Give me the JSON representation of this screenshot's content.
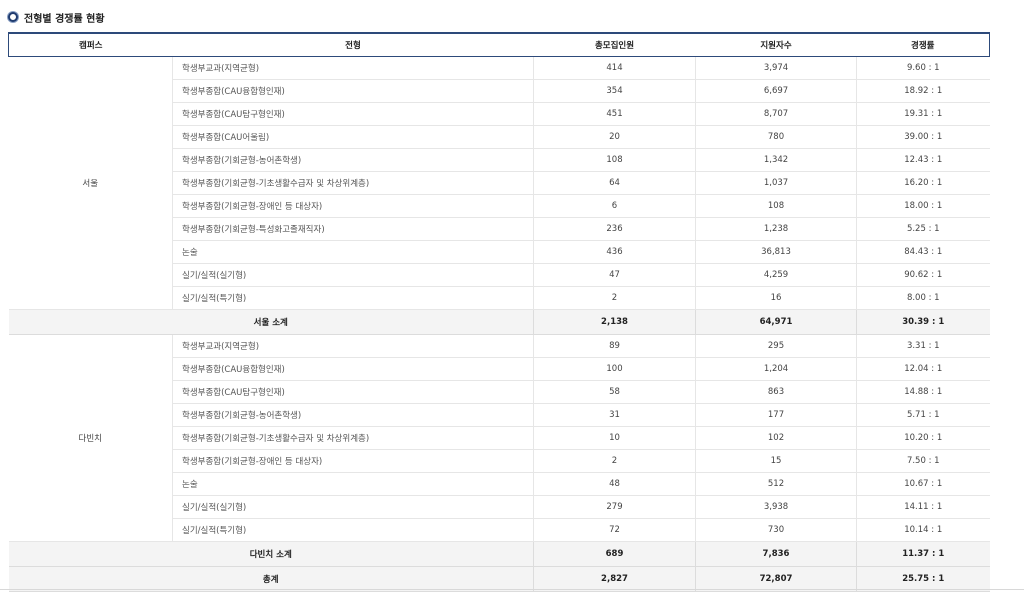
{
  "heading": "전형별 경쟁률 현황",
  "columns": [
    "캠퍼스",
    "전형",
    "총모집인원",
    "지원자수",
    "경쟁률"
  ],
  "seoul": {
    "campus": "서울",
    "rows": [
      {
        "type": "학생부교과(지역균형)",
        "quota": "414",
        "applicants": "3,974",
        "ratio": "9.60 : 1"
      },
      {
        "type": "학생부종합(CAU융합형인재)",
        "quota": "354",
        "applicants": "6,697",
        "ratio": "18.92 : 1"
      },
      {
        "type": "학생부종합(CAU탐구형인재)",
        "quota": "451",
        "applicants": "8,707",
        "ratio": "19.31 : 1"
      },
      {
        "type": "학생부종합(CAU어울림)",
        "quota": "20",
        "applicants": "780",
        "ratio": "39.00 : 1"
      },
      {
        "type": "학생부종합(기회균형-농어촌학생)",
        "quota": "108",
        "applicants": "1,342",
        "ratio": "12.43 : 1"
      },
      {
        "type": "학생부종합(기회균형-기초생활수급자 및 차상위계층)",
        "quota": "64",
        "applicants": "1,037",
        "ratio": "16.20 : 1"
      },
      {
        "type": "학생부종합(기회균형-장애인 등 대상자)",
        "quota": "6",
        "applicants": "108",
        "ratio": "18.00 : 1"
      },
      {
        "type": "학생부종합(기회균형-특성화고졸재직자)",
        "quota": "236",
        "applicants": "1,238",
        "ratio": "5.25 : 1"
      },
      {
        "type": "논술",
        "quota": "436",
        "applicants": "36,813",
        "ratio": "84.43 : 1"
      },
      {
        "type": "실기/실적(실기형)",
        "quota": "47",
        "applicants": "4,259",
        "ratio": "90.62 : 1"
      },
      {
        "type": "실기/실적(특기형)",
        "quota": "2",
        "applicants": "16",
        "ratio": "8.00 : 1"
      }
    ],
    "subtotal": {
      "label": "서울 소계",
      "quota": "2,138",
      "applicants": "64,971",
      "ratio": "30.39 : 1"
    }
  },
  "dabinchi": {
    "campus": "다빈치",
    "rows": [
      {
        "type": "학생부교과(지역균형)",
        "quota": "89",
        "applicants": "295",
        "ratio": "3.31 : 1"
      },
      {
        "type": "학생부종합(CAU융합형인재)",
        "quota": "100",
        "applicants": "1,204",
        "ratio": "12.04 : 1"
      },
      {
        "type": "학생부종합(CAU탐구형인재)",
        "quota": "58",
        "applicants": "863",
        "ratio": "14.88 : 1"
      },
      {
        "type": "학생부종합(기회균형-농어촌학생)",
        "quota": "31",
        "applicants": "177",
        "ratio": "5.71 : 1"
      },
      {
        "type": "학생부종합(기회균형-기초생활수급자 및 차상위계층)",
        "quota": "10",
        "applicants": "102",
        "ratio": "10.20 : 1"
      },
      {
        "type": "학생부종합(기회균형-장애인 등 대상자)",
        "quota": "2",
        "applicants": "15",
        "ratio": "7.50 : 1"
      },
      {
        "type": "논술",
        "quota": "48",
        "applicants": "512",
        "ratio": "10.67 : 1"
      },
      {
        "type": "실기/실적(실기형)",
        "quota": "279",
        "applicants": "3,938",
        "ratio": "14.11 : 1"
      },
      {
        "type": "실기/실적(특기형)",
        "quota": "72",
        "applicants": "730",
        "ratio": "10.14 : 1"
      }
    ],
    "subtotal": {
      "label": "다빈치 소계",
      "quota": "689",
      "applicants": "7,836",
      "ratio": "11.37 : 1"
    }
  },
  "total": {
    "label": "총계",
    "quota": "2,827",
    "applicants": "72,807",
    "ratio": "25.75 : 1"
  }
}
